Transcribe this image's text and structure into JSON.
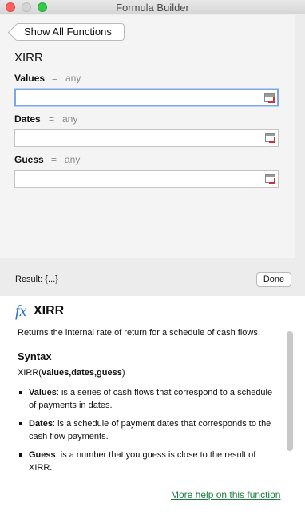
{
  "window": {
    "title": "Formula Builder"
  },
  "toolbar": {
    "back_label": "Show All Functions"
  },
  "function": {
    "name": "XIRR"
  },
  "args": [
    {
      "name": "Values",
      "eq": "=",
      "type": "any"
    },
    {
      "name": "Dates",
      "eq": "=",
      "type": "any"
    },
    {
      "name": "Guess",
      "eq": "=",
      "type": "any"
    }
  ],
  "result": {
    "text": "Result: {...}",
    "done_label": "Done"
  },
  "help": {
    "fx": "fx",
    "title": "XIRR",
    "description": "Returns the internal rate of return for a schedule of cash flows.",
    "syntax_heading": "Syntax",
    "syntax_prefix": "XIRR(",
    "syntax_args": "values,dates,guess",
    "syntax_suffix": ")",
    "params": [
      {
        "name": "Values",
        "text": ": is a series of cash flows that correspond to a schedule of payments in dates."
      },
      {
        "name": "Dates",
        "text": ": is a schedule of payment dates that corresponds to the cash flow payments."
      },
      {
        "name": "Guess",
        "text": ": is a number that you guess is close to the result of XIRR."
      }
    ],
    "more_link": "More help on this function"
  },
  "colors": {
    "accent": "#2a73c9",
    "link": "#1a7a40",
    "focus": "#7ea6e0"
  },
  "icons": [
    "close-window-icon",
    "minimize-window-icon",
    "maximize-window-icon",
    "collapse-dialog-icon",
    "fx-icon"
  ]
}
